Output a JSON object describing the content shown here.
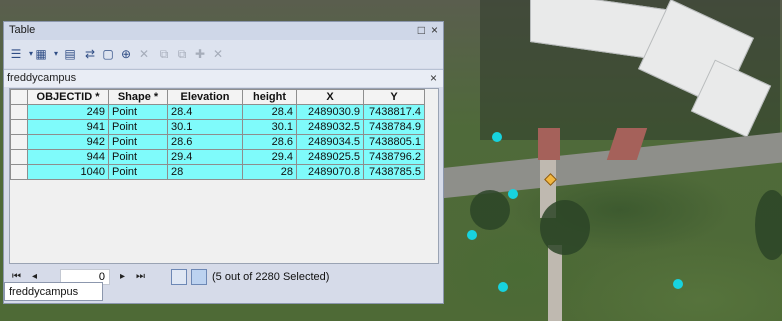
{
  "window": {
    "title": "Table",
    "maximize_icon": "□",
    "close_icon": "×"
  },
  "toolbar": {
    "icons": [
      "table-options-icon",
      "related-tables-icon",
      "select-by-attributes-icon",
      "switch-selection-icon",
      "clear-selection-icon",
      "zoom-to-selected-icon",
      "delete-selected-icon",
      "copy-icon",
      "paste-icon",
      "add-icon",
      "delete-icon"
    ]
  },
  "table_tab": {
    "name": "freddycampus",
    "close_icon": "×"
  },
  "columns": [
    "OBJECTID *",
    "Shape *",
    "Elevation",
    "height",
    "X",
    "Y"
  ],
  "rows": [
    {
      "objectid": "249",
      "shape": "Point",
      "elevation": "28.4",
      "height": "28.4",
      "x": "2489030.9",
      "y": "7438817.4"
    },
    {
      "objectid": "941",
      "shape": "Point",
      "elevation": "30.1",
      "height": "30.1",
      "x": "2489032.5",
      "y": "7438784.9"
    },
    {
      "objectid": "942",
      "shape": "Point",
      "elevation": "28.6",
      "height": "28.6",
      "x": "2489034.5",
      "y": "7438805.1"
    },
    {
      "objectid": "944",
      "shape": "Point",
      "elevation": "29.4",
      "height": "29.4",
      "x": "2489025.5",
      "y": "7438796.2"
    },
    {
      "objectid": "1040",
      "shape": "Point",
      "elevation": "28",
      "height": "28",
      "x": "2489070.8",
      "y": "7438785.5"
    }
  ],
  "navigation": {
    "first": "⏮",
    "prev": "◂",
    "record": "0",
    "next": "▸",
    "last": "⏭",
    "status": "(5 out of 2280 Selected)"
  },
  "bottom_tab": {
    "label": "freddycampus"
  },
  "colors": {
    "selected_row": "#7ffbfb",
    "point_symbol": "#17d3df",
    "selected_point": "#f2b640"
  }
}
